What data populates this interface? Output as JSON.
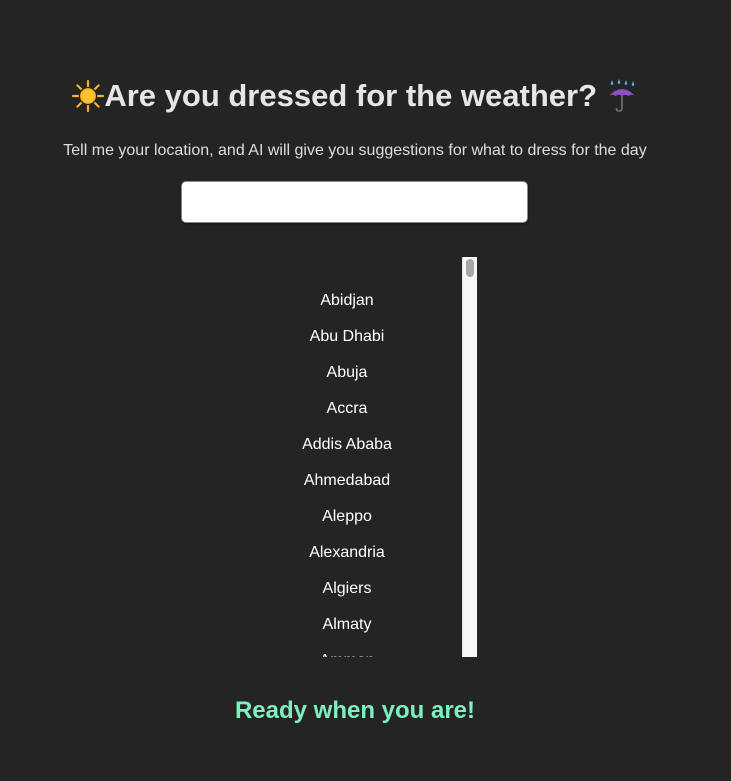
{
  "header": {
    "title": "Are you dressed for the weather?",
    "leading_icon": "sun-icon",
    "trailing_icon": "umbrella-rain-icon",
    "subtitle": "Tell me your location, and AI will give you suggestions for what to dress for the day"
  },
  "search": {
    "value": "",
    "placeholder": ""
  },
  "cities": [
    "Abidjan",
    "Abu Dhabi",
    "Abuja",
    "Accra",
    "Addis Ababa",
    "Ahmedabad",
    "Aleppo",
    "Alexandria",
    "Algiers",
    "Almaty",
    "Amman"
  ],
  "status": {
    "text": "Ready when you are!",
    "color": "#7cf0bd"
  },
  "colors": {
    "background": "#242424",
    "text": "#e6e6e6"
  }
}
